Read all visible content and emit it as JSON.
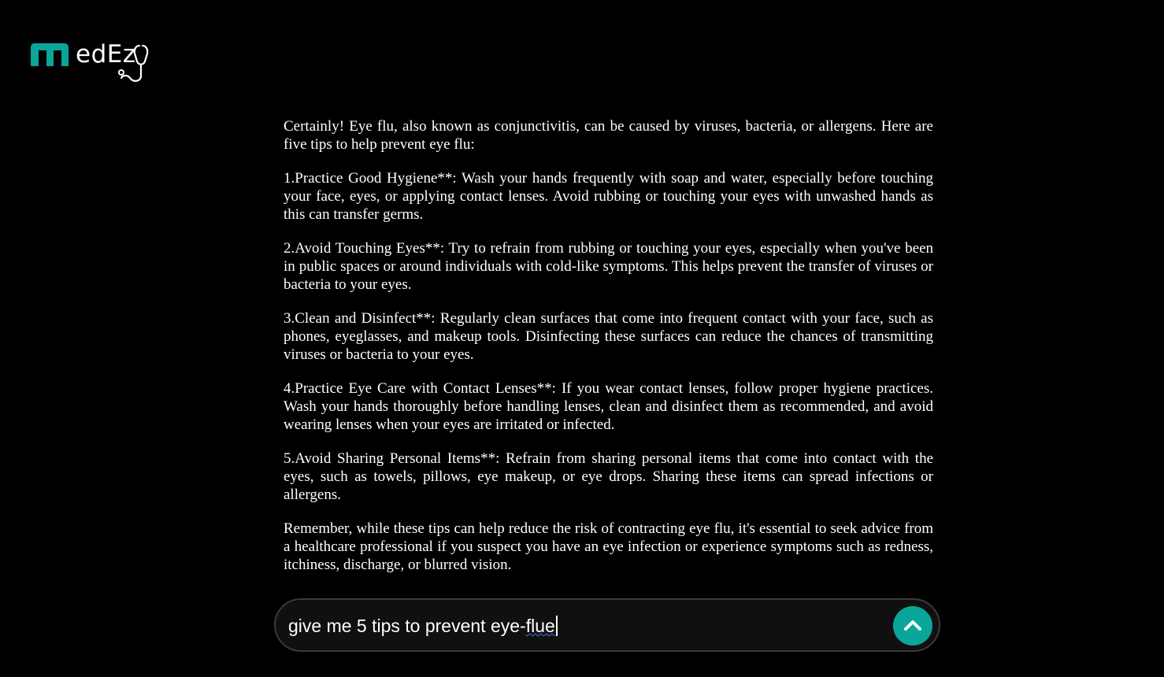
{
  "brand": {
    "logo_text": "edEz",
    "accent_color": "#0aa699"
  },
  "response": {
    "paragraphs": [
      "Certainly! Eye flu, also known as conjunctivitis, can be caused by viruses, bacteria, or allergens. Here are five tips to help prevent eye flu:",
      "1.Practice Good Hygiene**: Wash your hands frequently with soap and water, especially before touching your face, eyes, or applying contact lenses. Avoid rubbing or touching your eyes with unwashed hands as this can transfer germs.",
      "2.Avoid Touching Eyes**: Try to refrain from rubbing or touching your eyes, especially when you've been in public spaces or around individuals with cold-like symptoms. This helps prevent the transfer of viruses or bacteria to your eyes.",
      "3.Clean and Disinfect**: Regularly clean surfaces that come into frequent contact with your face, such as phones, eyeglasses, and makeup tools. Disinfecting these surfaces can reduce the chances of transmitting viruses or bacteria to your eyes.",
      "4.Practice Eye Care with Contact Lenses**: If you wear contact lenses, follow proper hygiene practices. Wash your hands thoroughly before handling lenses, clean and disinfect them as recommended, and avoid wearing lenses when your eyes are irritated or infected.",
      "5.Avoid Sharing Personal Items**: Refrain from sharing personal items that come into contact with the eyes, such as towels, pillows, eye makeup, or eye drops. Sharing these items can spread infections or allergens.",
      "Remember, while these tips can help reduce the risk of contracting eye flu, it's essential to seek advice from a healthcare professional if you suspect you have an eye infection or experience symptoms such as redness, itchiness, discharge, or blurred vision."
    ]
  },
  "prompt": {
    "value_prefix": "give me 5 tips to prevent eye-",
    "value_misspelled": "flue",
    "send_icon": "chevron-up-icon"
  }
}
